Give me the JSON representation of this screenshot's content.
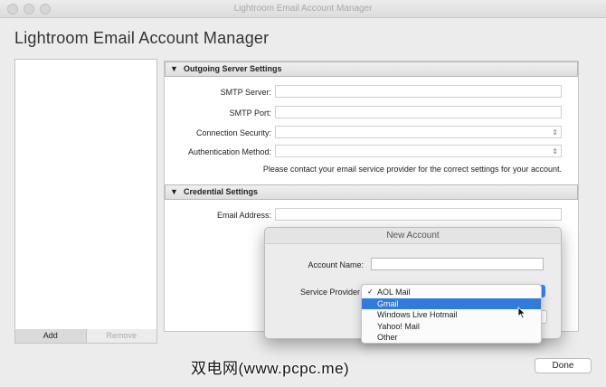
{
  "window": {
    "title": "Lightroom Email Account Manager"
  },
  "app": {
    "heading": "Lightroom Email Account Manager"
  },
  "accounts": {
    "add_label": "Add",
    "remove_label": "Remove"
  },
  "outgoing": {
    "title": "Outgoing Server Settings",
    "smtp_server_label": "SMTP Server:",
    "smtp_port_label": "SMTP Port:",
    "connection_security_label": "Connection Security:",
    "authentication_method_label": "Authentication Method:",
    "note": "Please contact your email service provider for the correct settings for your account."
  },
  "credential": {
    "title": "Credential Settings",
    "email_label": "Email Address:"
  },
  "dialog": {
    "title": "New Account",
    "account_name_label": "Account Name:",
    "service_provider_label": "Service Provider",
    "options": [
      {
        "label": "AOL Mail",
        "checked": true
      },
      {
        "label": "Gmail",
        "highlighted": true
      },
      {
        "label": "Windows Live Hotmail"
      },
      {
        "label": "Yahoo! Mail"
      },
      {
        "label": "Other"
      }
    ]
  },
  "footer": {
    "done_label": "Done"
  },
  "watermark": {
    "text": "双电网(www.pcpc.me)"
  },
  "colors": {
    "highlight": "#2f7be0",
    "popup_button": "#3b82f6"
  }
}
